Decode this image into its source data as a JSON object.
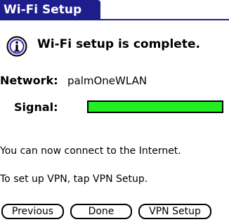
{
  "title": "Wi-Fi Setup",
  "colors": {
    "title_bar": "#1d1d8d",
    "signal_fill": "#22ee22",
    "info_icon_outer": "#dddddd",
    "info_icon_inner": "#0000cc"
  },
  "status": {
    "icon": "info-icon",
    "headline": "Wi-Fi setup is complete."
  },
  "network": {
    "label": "Network:",
    "value": "palmOneWLAN"
  },
  "signal": {
    "label": "Signal:",
    "level_percent": 100
  },
  "messages": [
    "You can now connect to the Internet.",
    "To set up VPN, tap VPN Setup."
  ],
  "buttons": {
    "previous": "Previous",
    "done": "Done",
    "vpn_setup": "VPN Setup"
  }
}
